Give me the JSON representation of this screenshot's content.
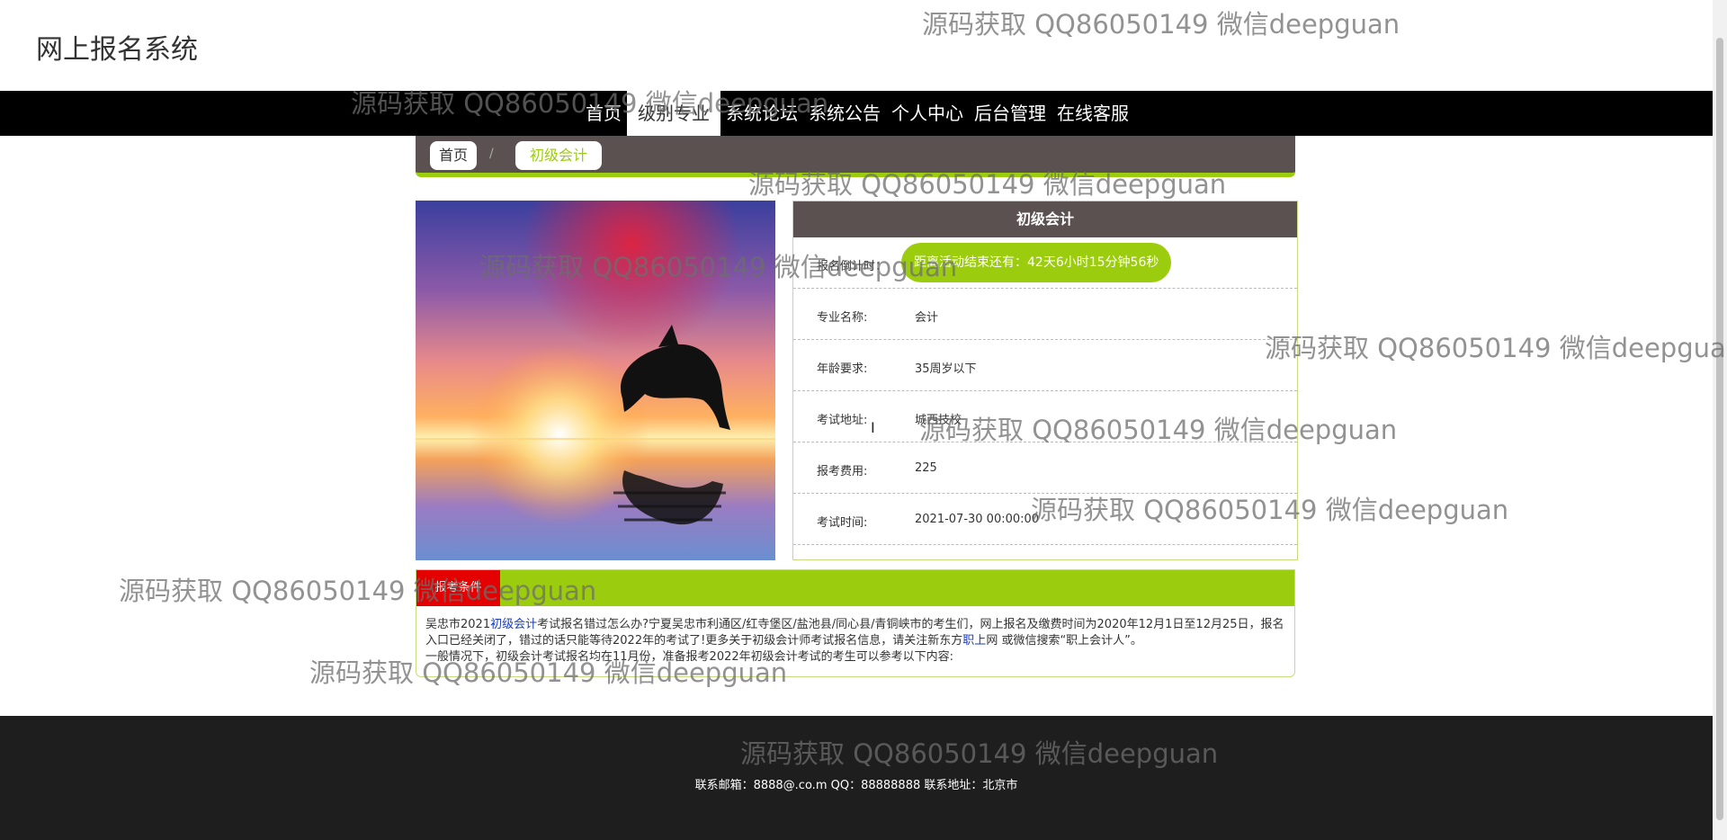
{
  "site": {
    "title": "网上报名系统"
  },
  "nav": {
    "items": [
      "首页",
      "级别专业",
      "系统论坛",
      "系统公告",
      "个人中心",
      "后台管理",
      "在线客服"
    ],
    "active": "级别专业"
  },
  "breadcrumb": {
    "home": "首页",
    "separator": "/",
    "current": "初级会计"
  },
  "detail": {
    "title": "初级会计",
    "countdown_label": "报名倒计时：",
    "countdown_text": "距离活动结束还有：42天6小时15分钟56秒",
    "rows": [
      {
        "label": "专业名称:",
        "value": "会计"
      },
      {
        "label": "年龄要求:",
        "value": "35周岁以下"
      },
      {
        "label": "考试地址:",
        "value": "城西技校"
      },
      {
        "label": "报考费用:",
        "value": "225"
      },
      {
        "label": "考试时间:",
        "value": "2021-07-30 00:00:00"
      }
    ]
  },
  "conditions": {
    "tab": "报考条件",
    "p1_a": "吴忠市2021",
    "p1_link": "初级会计",
    "p1_b": "考试报名错过怎么办?宁夏吴忠市利通区/红寺堡区/盐池县/同心县/青铜峡市的考生们，网上报名及缴费时间为2020年12月1日至12月25日，报名入口已经关闭了，错过的话只能等待2022年的考试了!更多关于初级会计师考试报名信息，请关注新东方",
    "p1_link2": "职上",
    "p1_c": "网 或微信搜索“职上会计人”。",
    "p2": "一般情况下，初级会计考试报名均在11月份，准备报考2022年初级会计考试的考生可以参考以下内容:"
  },
  "footer": {
    "text": "联系邮箱：8888@.co.m QQ：88888888 联系地址：北京市"
  },
  "watermark": "源码获取 QQ86050149 微信deepguan",
  "colors": {
    "accent": "#9ccc0e",
    "header_bg": "#5b5150",
    "nav_bg": "#000000",
    "tab_red": "#e40000",
    "footer_bg": "#1e1e1e"
  }
}
